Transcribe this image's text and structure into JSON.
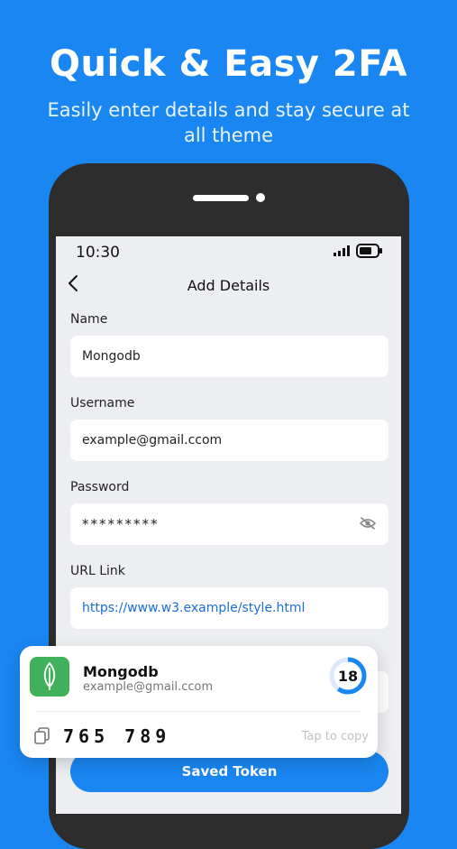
{
  "promo": {
    "headline": "Quick & Easy 2FA",
    "subline": "Easily enter details and stay secure at all theme"
  },
  "status_bar": {
    "time": "10:30"
  },
  "header": {
    "title": "Add Details"
  },
  "form": {
    "name_label": "Name",
    "name_value": "Mongodb",
    "username_label": "Username",
    "username_value": "example@gmail.ccom",
    "password_label": "Password",
    "password_value": "*********",
    "url_label": "URL Link",
    "url_value": "https://www.w3.example/style.html"
  },
  "token_card": {
    "app_name": "Mongodb",
    "username": "example@gmail.ccom",
    "timer_value": "18",
    "timer_fraction_remaining": 0.6,
    "token": "765789",
    "token_display": "765 789",
    "tap_to_copy": "Tap to copy"
  },
  "actions": {
    "save_label": "Saved Token"
  },
  "colors": {
    "background": "#1a86f2",
    "accent": "#1a86f2",
    "app_icon": "#41b05a",
    "link": "#1a6ed8"
  },
  "icons": [
    "back-chevron-icon",
    "signal-icon",
    "battery-icon",
    "eye-off-icon",
    "leaf-icon",
    "copy-icon"
  ]
}
